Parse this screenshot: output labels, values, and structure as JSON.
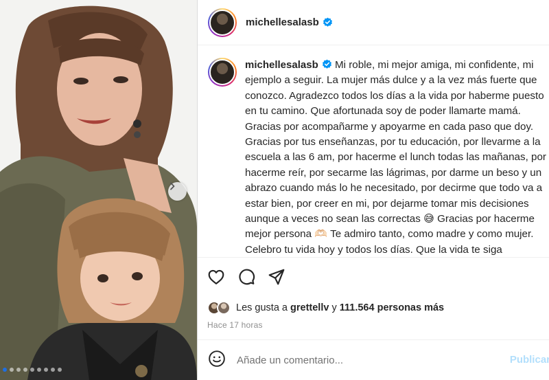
{
  "post": {
    "username": "michellesalasb",
    "verified_icon": "verified-badge-icon",
    "photo": {
      "next_icon": "chevron-right-icon",
      "slide_count": 9,
      "active_slide": 1
    }
  },
  "caption": {
    "username": "michellesalasb",
    "text": "Mi roble, mi mejor amiga, mi confidente, mi ejemplo a seguir. La mujer más dulce y a la vez más fuerte que conozco. Agradezco todos los días a la vida por haberme puesto en tu camino. Que afortunada soy de poder llamarte mamá. Gracias por acompañarme y apoyarme en cada paso que doy. Gracias por tus enseñanzas, por tu educación, por llevarme a la escuela a las 6 am, por hacerme el lunch todas las mañanas, por hacerme reír, por secarme las lágrimas, por darme un beso y un abrazo cuando más lo he necesitado, por decirme que todo va a estar bien, por creer en mi, por dejarme tomar mis decisiones aunque a veces no sean las correctas 😅 Gracias por hacerme mejor persona 🫶🏻 Te admiro tanto, como madre y como mujer. Celebro tu vida hoy y todos los días. Que la vida te siga sonriendo siempre. Te amo infinito!!! Siempre juntitas y así"
  },
  "actions": {
    "like_icon": "heart-icon",
    "comment_icon": "comment-bubble-icon",
    "share_icon": "paper-plane-icon"
  },
  "likes": {
    "prefix": "Les gusta a",
    "user": "grettellv",
    "connector": "y",
    "count_text": "111.564 personas más"
  },
  "timestamp": "Hace 17 horas",
  "comment_box": {
    "emoji_icon": "smiley-icon",
    "placeholder": "Añade un comentario...",
    "publish_label": "Publicar"
  },
  "colors": {
    "verified": "#0095f6",
    "publish_disabled": "#b2dffc",
    "secondary_text": "#8e8e8e"
  }
}
